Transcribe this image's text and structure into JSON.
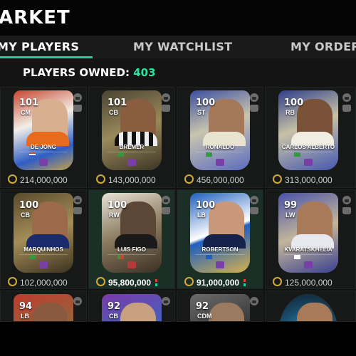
{
  "header": {
    "title": "ARKET"
  },
  "tabs": [
    {
      "label": "MY PLAYERS",
      "active": true
    },
    {
      "label": "MY WATCHLIST",
      "active": false
    },
    {
      "label": "MY ORDERS",
      "active": false
    }
  ],
  "owned": {
    "label": "PLAYERS OWNED:",
    "count": "403"
  },
  "colors": {
    "accent": "#19d39a",
    "coin": "#d4aa3b"
  },
  "players": [
    {
      "name": "DE JONG",
      "rating": "101",
      "position": "CM",
      "price": "214,000,000",
      "locked": true,
      "selected": false
    },
    {
      "name": "BREMER",
      "rating": "101",
      "position": "CB",
      "price": "143,000,000",
      "locked": true,
      "selected": false
    },
    {
      "name": "RONALDO",
      "rating": "100",
      "position": "ST",
      "price": "456,000,000",
      "locked": true,
      "selected": false
    },
    {
      "name": "CARLOS ALBERTO",
      "rating": "100",
      "position": "RB",
      "price": "313,000,000",
      "locked": true,
      "selected": false
    },
    {
      "name": "MARQUINHOS",
      "rating": "100",
      "position": "CB",
      "price": "102,000,000",
      "locked": true,
      "selected": false
    },
    {
      "name": "LUIS FIGO",
      "rating": "100",
      "position": "RW",
      "price": "95,800,000",
      "locked": true,
      "selected": true
    },
    {
      "name": "ROBERTSON",
      "rating": "100",
      "position": "LB",
      "price": "91,000,000",
      "locked": true,
      "selected": true
    },
    {
      "name": "KVARATSKHELIA",
      "rating": "99",
      "position": "LW",
      "price": "125,000,000",
      "locked": true,
      "selected": false
    },
    {
      "name": "",
      "rating": "94",
      "position": "LB",
      "price": "",
      "locked": true,
      "selected": false
    },
    {
      "name": "",
      "rating": "92",
      "position": "CB",
      "price": "",
      "locked": true,
      "selected": false
    },
    {
      "name": "",
      "rating": "92",
      "position": "CDM",
      "price": "",
      "locked": true,
      "selected": false
    },
    {
      "name": "",
      "rating": "",
      "position": "",
      "price": "",
      "locked": false,
      "selected": false
    }
  ]
}
